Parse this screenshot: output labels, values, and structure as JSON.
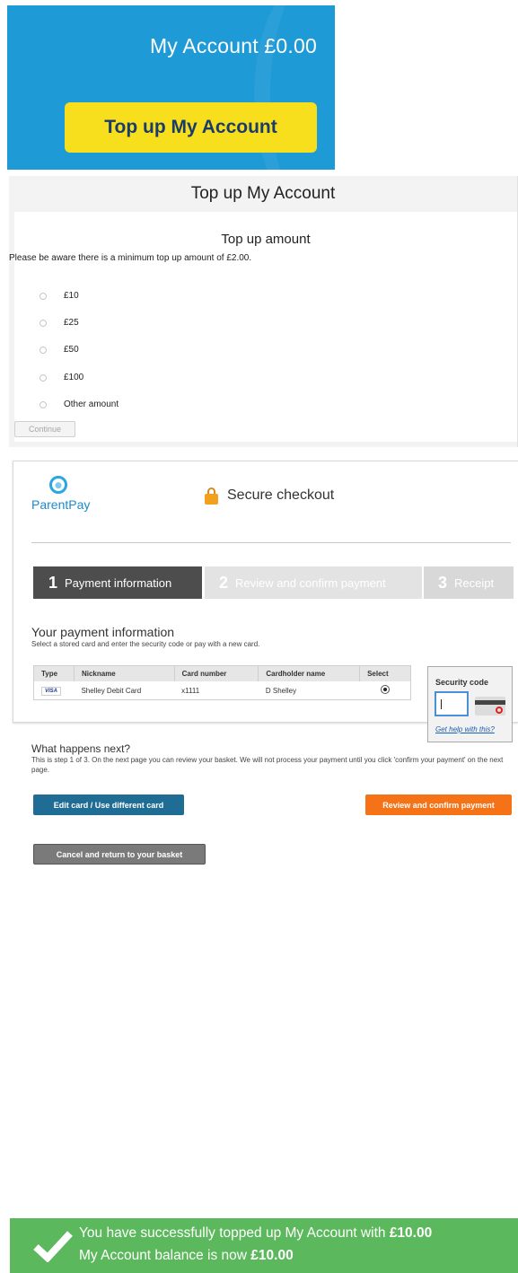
{
  "account_banner": {
    "title": "My Account £0.00",
    "topup_button": "Top up My Account",
    "colors": {
      "background": "#1e9ad6",
      "button": "#f7df1e",
      "button_text": "#1b3c6b"
    }
  },
  "topup_form": {
    "header": "Top up My Account",
    "amount_heading": "Top up amount",
    "minimum_notice": "Please be aware there is a minimum top up amount of £2.00.",
    "options": [
      {
        "label": "£10",
        "selected": false
      },
      {
        "label": "£25",
        "selected": false
      },
      {
        "label": "£50",
        "selected": false
      },
      {
        "label": "£100",
        "selected": false
      },
      {
        "label": "Other amount",
        "selected": false
      }
    ],
    "continue_button": "Continue"
  },
  "checkout": {
    "logo_text": "ParentPay",
    "secure_label": "Secure checkout",
    "steps": [
      {
        "number": "1",
        "label": "Payment information",
        "active": true
      },
      {
        "number": "2",
        "label": "Review and confirm payment",
        "active": false
      },
      {
        "number": "3",
        "label": "Receipt",
        "active": false
      }
    ],
    "payment_heading": "Your payment information",
    "payment_subtext": "Select a stored card and enter the security code or pay with a new card.",
    "table": {
      "headers": [
        "Type",
        "Nickname",
        "Card number",
        "Cardholder name",
        "Select"
      ],
      "rows": [
        {
          "type": "VISA",
          "nickname": "Shelley Debit Card",
          "card_number": "x1111",
          "cardholder": "D Shelley",
          "selected": true
        }
      ]
    },
    "security": {
      "label": "Security code",
      "input_value": "",
      "help_link": "Get help with this?"
    },
    "next_heading": "What happens next?",
    "next_text": "This is step 1 of 3. On the next page you can review your basket. We will not process your payment until you click 'confirm your payment' on the next page.",
    "buttons": {
      "edit_card": "Edit card / Use different card",
      "review": "Review and confirm payment",
      "cancel": "Cancel and return to your basket"
    },
    "colors": {
      "edit": "#1f6c94",
      "review": "#f57216",
      "cancel": "#7a7a7a",
      "active_step": "#4d4d4d"
    }
  },
  "success": {
    "line1_prefix": "You have successfully topped up My Account with ",
    "line1_amount": "£10.00",
    "line2_prefix": "My Account balance is now ",
    "line2_amount": "£10.00",
    "color": "#5cb85c"
  }
}
